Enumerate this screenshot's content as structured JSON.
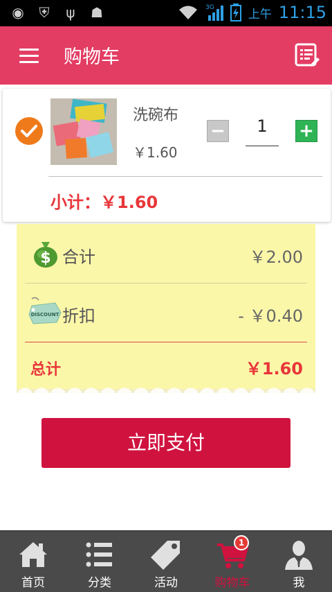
{
  "status_bar": {
    "network": "3G",
    "ampm": "上午",
    "time": "11:15"
  },
  "header": {
    "title": "购物车",
    "menu_icon": "hamburger-icon",
    "action_icon": "note-icon"
  },
  "cart_item": {
    "selected": true,
    "name": "洗碗布",
    "price": "￥1.60",
    "quantity": "1",
    "minus_label": "−",
    "plus_label": "+",
    "subtotal": "小计：￥1.60"
  },
  "summary": {
    "total_label": "合计",
    "total_value": "￥2.00",
    "discount_label": "折扣",
    "discount_value": "- ￥0.40",
    "grand_total_label": "总计",
    "grand_total_value": "￥1.60"
  },
  "pay_button": "立即支付",
  "tabs": [
    {
      "label": "首页",
      "icon": "home-icon"
    },
    {
      "label": "分类",
      "icon": "list-icon"
    },
    {
      "label": "活动",
      "icon": "tag-icon"
    },
    {
      "label": "购物车",
      "icon": "cart-icon",
      "badge": "1",
      "active": true
    },
    {
      "label": "我",
      "icon": "user-icon"
    }
  ],
  "colors": {
    "accent": "#e33d64",
    "pay": "#d0123f",
    "price_red": "#e8363a",
    "tab_bg": "#4a4a4a"
  }
}
